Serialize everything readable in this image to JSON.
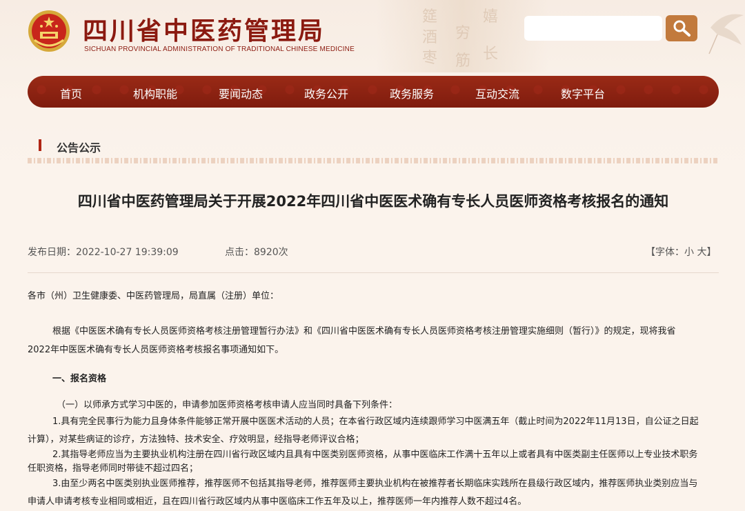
{
  "site": {
    "title": "四川省中医药管理局",
    "subtitle": "SICHUAN PROVINCIAL ADMINISTRATION OF TRADITIONAL CHINESE MEDICINE"
  },
  "search": {
    "placeholder": "",
    "value": ""
  },
  "nav": {
    "items": [
      "首页",
      "机构职能",
      "要闻动态",
      "政务公开",
      "政务服务",
      "互动交流",
      "数字平台"
    ]
  },
  "section": {
    "title": "公告公示"
  },
  "article": {
    "title": "四川省中医药管理局关于开展2022年四川省中医医术确有专长人员医师资格考核报名的通知",
    "publish_date": "发布日期：2022-10-27 19:39:09",
    "clicks": "点击：8920次",
    "font_size_control": "【字体：小 大】",
    "salutation": "各市（州）卫生健康委、中医药管理局，局直属（注册）单位：",
    "intro_line1": "根据《中医医术确有专长人员医师资格考核注册管理暂行办法》和《四川省中医医术确有专长人员医师资格考核注册管理实施细则（暂行）》的规定，现将我省",
    "intro_line2": "2022年中医医术确有专长人员医师资格考核报名事项通知如下。",
    "heading1": "一、报名资格",
    "sub1": "（一）以师承方式学习中医的，申请参加医师资格考核申请人应当同时具备下列条件：",
    "item1_line1": "1.具有完全民事行为能力且身体条件能够正常开展中医医术活动的人员；在本省行政区域内连续跟师学习中医满五年（截止时间为2022年11月13日，自公证之日起",
    "item1_line2": "计算），对某些病证的诊疗，方法独特、技术安全、疗效明显，经指导老师评议合格；",
    "item2_line1": "2.其指导老师应当为主要执业机构注册在四川省行政区域内且具有中医类别医师资格，从事中医临床工作满十五年以上或者具有中医类副主任医师以上专业技术职务",
    "item2_line2": "任职资格，指导老师同时带徒不超过四名；",
    "item3_line1": "3.由至少两名中医类别执业医师推荐，推荐医师不包括其指导老师，推荐医师主要执业机构在被推荐者长期临床实践所在县级行政区域内，推荐医师执业类别应当与",
    "item3_line2": "申请人申请考核专业相同或相近，且在四川省行政区域内从事中医临床工作五年及以上，推荐医师一年内推荐人数不超过4名。"
  },
  "colors": {
    "brand_red": "#8b1a10",
    "nav_bg": "#8f2413",
    "search_button": "#c27a3d",
    "page_bg": "#fbf3ec"
  },
  "icons": {
    "emblem": "national-emblem-icon",
    "search": "search-icon",
    "crane": "crane-decoration-icon"
  }
}
